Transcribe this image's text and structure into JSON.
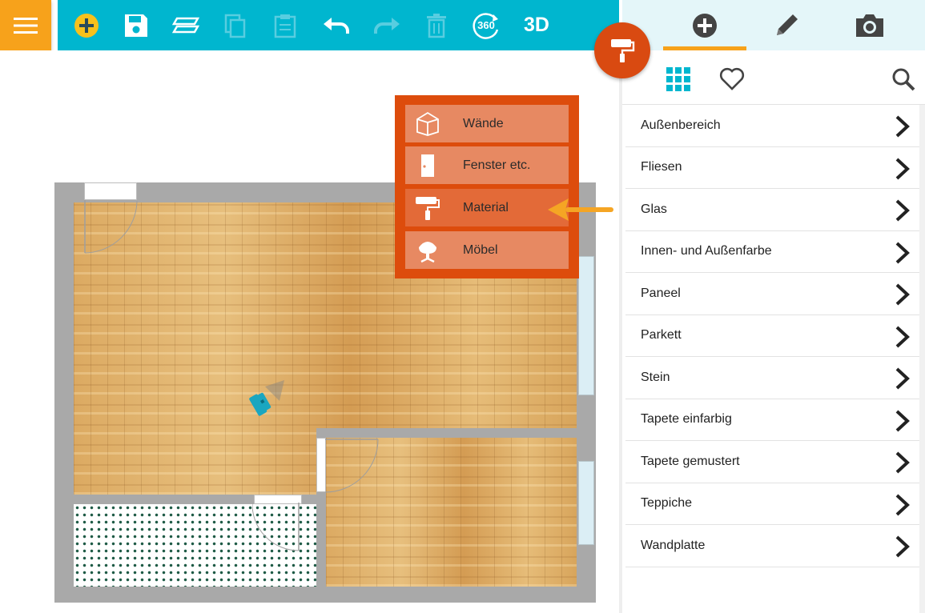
{
  "toolbar": {
    "menu_icon": "hamburger-icon",
    "buttons": [
      {
        "name": "add",
        "icon": "plus-circle-icon"
      },
      {
        "name": "save",
        "icon": "floppy-icon"
      },
      {
        "name": "floors",
        "icon": "layers-icon"
      },
      {
        "name": "copy",
        "icon": "copy-icon"
      },
      {
        "name": "paste",
        "icon": "clipboard-icon"
      },
      {
        "name": "undo",
        "icon": "undo-icon"
      },
      {
        "name": "redo",
        "icon": "redo-icon"
      },
      {
        "name": "delete",
        "icon": "trash-icon"
      },
      {
        "name": "view-360",
        "label": "360"
      },
      {
        "name": "view-3d",
        "label": "3D"
      }
    ],
    "accent": "#00b6cf",
    "menu_color": "#f7a21b"
  },
  "popup": {
    "items": [
      {
        "label": "Wände",
        "icon": "walls-icon"
      },
      {
        "label": "Fenster etc.",
        "icon": "door-icon"
      },
      {
        "label": "Material",
        "icon": "paint-roller-icon",
        "active": true
      },
      {
        "label": "Möbel",
        "icon": "chair-icon"
      }
    ],
    "color": "#dd4c0c"
  },
  "panel": {
    "tabs": [
      {
        "name": "add",
        "icon": "plus-circle-icon",
        "active": true
      },
      {
        "name": "edit",
        "icon": "pencil-icon"
      },
      {
        "name": "photo",
        "icon": "camera-icon"
      }
    ],
    "subtabs": [
      {
        "name": "grid",
        "icon": "grid-icon"
      },
      {
        "name": "favorites",
        "icon": "heart-icon"
      },
      {
        "name": "search",
        "icon": "search-icon"
      }
    ],
    "categories": [
      {
        "label": "Außenbereich"
      },
      {
        "label": "Fliesen"
      },
      {
        "label": "Glas"
      },
      {
        "label": "Innen- und Außenfarbe"
      },
      {
        "label": "Paneel"
      },
      {
        "label": "Parkett"
      },
      {
        "label": "Stein"
      },
      {
        "label": "Tapete einfarbig"
      },
      {
        "label": "Tapete gemustert"
      },
      {
        "label": "Teppiche"
      },
      {
        "label": "Wandplatte"
      }
    ]
  }
}
